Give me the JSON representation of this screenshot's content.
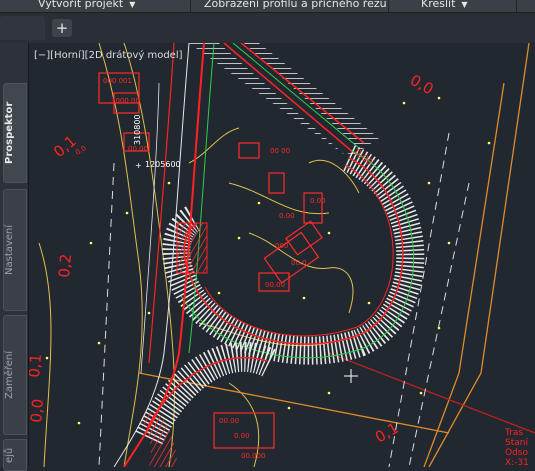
{
  "menu": {
    "create_project": "Vytvořit projekt",
    "profile_view": "Zobrazení profilu a příčného řezu",
    "draw": "Kreslit"
  },
  "tabs": {
    "add": "+"
  },
  "palette": {
    "prospector": "Prospektor",
    "settings": "Nastavení",
    "survey": "Zaměření",
    "partial": "ejů"
  },
  "viewport": {
    "label": "[−][Horní][2D drátový model]",
    "coord_a": "310800",
    "coord_b": "1205600",
    "labels": [
      "0,0",
      "0,1",
      "0,2",
      "0,1",
      "0,0",
      "0,1",
      "0,00"
    ],
    "info": [
      "Tras",
      "Staní",
      "Odso",
      "X:-31"
    ]
  },
  "colors": {
    "background": "#212830",
    "road": "#ff2222",
    "hatch": "#e8e8e8",
    "contour": "#e0c24a",
    "boundary": "#e08a2a",
    "points": "#ffff66"
  }
}
